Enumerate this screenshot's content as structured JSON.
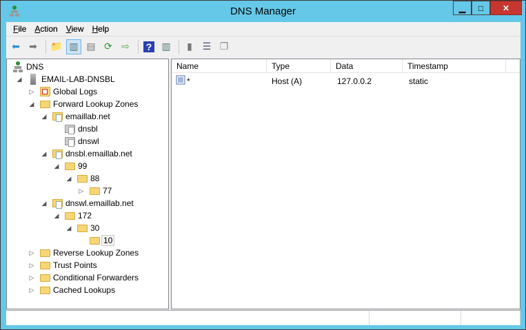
{
  "window": {
    "title": "DNS Manager",
    "min": "▁",
    "max": "□",
    "close": "✕"
  },
  "menu": [
    {
      "label": "File",
      "key": "F",
      "rest": "ile"
    },
    {
      "label": "Action",
      "key": "A",
      "rest": "ction"
    },
    {
      "label": "View",
      "key": "V",
      "rest": "iew"
    },
    {
      "label": "Help",
      "key": "H",
      "rest": "elp"
    }
  ],
  "toolbar": [
    "back-icon",
    "forward-icon",
    "up-folder-icon",
    "show-hide-tree-icon",
    "properties-icon",
    "refresh-icon",
    "export-list-icon",
    "help-icon",
    "show-action-pane-icon",
    "server-icon",
    "record-list-icon",
    "copy-icon"
  ],
  "tree": [
    {
      "label": "DNS",
      "level": 0,
      "exp": "",
      "icon": "dns"
    },
    {
      "label": "EMAIL-LAB-DNSBL",
      "level": 1,
      "exp": "◢",
      "icon": "server"
    },
    {
      "label": "Global Logs",
      "level": 2,
      "exp": "▷",
      "icon": "log"
    },
    {
      "label": "Forward Lookup Zones",
      "level": 2,
      "exp": "◢",
      "icon": "folder"
    },
    {
      "label": "emaillab.net",
      "level": 3,
      "exp": "◢",
      "icon": "zone"
    },
    {
      "label": "dnsbl",
      "level": 4,
      "exp": "",
      "icon": "zonegray"
    },
    {
      "label": "dnswl",
      "level": 4,
      "exp": "",
      "icon": "zonegray"
    },
    {
      "label": "dnsbl.emaillab.net",
      "level": 3,
      "exp": "◢",
      "icon": "zone"
    },
    {
      "label": "99",
      "level": 4,
      "exp": "◢",
      "icon": "folder"
    },
    {
      "label": "88",
      "level": 5,
      "exp": "◢",
      "icon": "folder"
    },
    {
      "label": "77",
      "level": 6,
      "exp": "▷",
      "icon": "folder"
    },
    {
      "label": "dnswl.emaillab.net",
      "level": 3,
      "exp": "◢",
      "icon": "zone"
    },
    {
      "label": "172",
      "level": 4,
      "exp": "◢",
      "icon": "folder"
    },
    {
      "label": "30",
      "level": 5,
      "exp": "◢",
      "icon": "folder"
    },
    {
      "label": "10",
      "level": 6,
      "exp": "",
      "icon": "folder",
      "selected": true
    },
    {
      "label": "Reverse Lookup Zones",
      "level": 2,
      "exp": "▷",
      "icon": "folder"
    },
    {
      "label": "Trust Points",
      "level": 2,
      "exp": "▷",
      "icon": "folder"
    },
    {
      "label": "Conditional Forwarders",
      "level": 2,
      "exp": "▷",
      "icon": "folder"
    },
    {
      "label": "Cached Lookups",
      "level": 2,
      "exp": "▷",
      "icon": "folder"
    }
  ],
  "list": {
    "columns": [
      "Name",
      "Type",
      "Data",
      "Timestamp"
    ],
    "rows": [
      {
        "name": "*",
        "type": "Host (A)",
        "data": "127.0.0.2",
        "timestamp": "static"
      }
    ]
  }
}
